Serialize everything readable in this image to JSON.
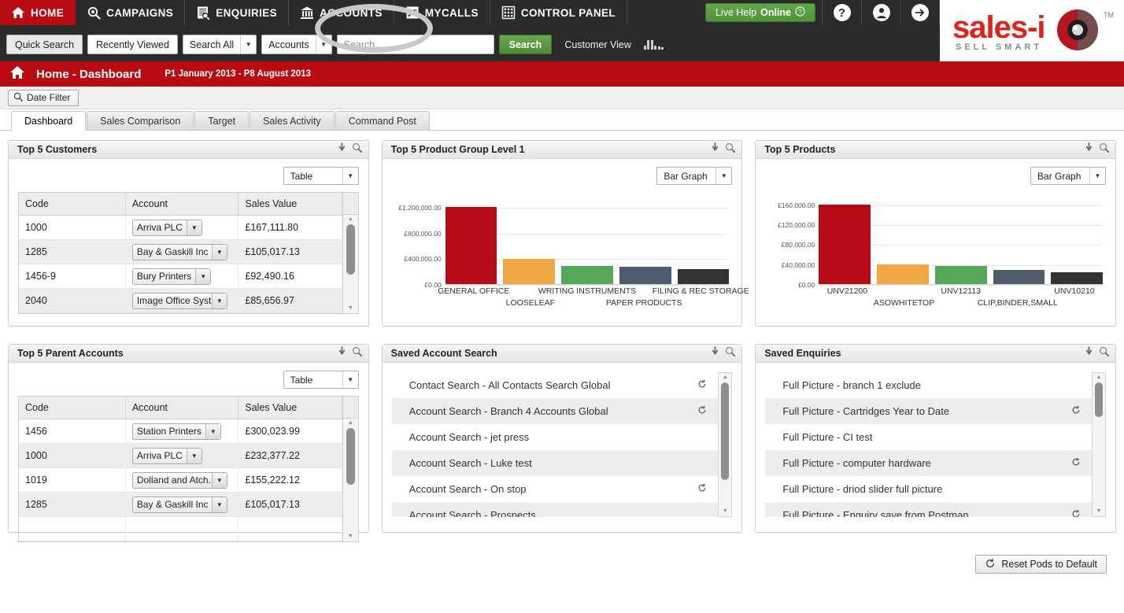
{
  "topnav": {
    "items": [
      {
        "label": "HOME",
        "icon": "home-icon",
        "active": true
      },
      {
        "label": "CAMPAIGNS",
        "icon": "campaigns-icon",
        "active": false
      },
      {
        "label": "ENQUIRIES",
        "icon": "enquiries-icon",
        "active": false
      },
      {
        "label": "ACCOUNTS",
        "icon": "accounts-bank-icon",
        "active": false
      },
      {
        "label": "MYCALLS",
        "icon": "mycalls-checklist-icon",
        "active": false
      },
      {
        "label": "CONTROL PANEL",
        "icon": "control-panel-icon",
        "active": false
      }
    ],
    "live_help": {
      "prefix": "Live Help ",
      "strong": "Online",
      "icon": "info-circle-icon"
    },
    "help_icon": "question-mark-icon",
    "account_icon": "user-avatar-icon",
    "logout_icon": "arrow-right-circle-icon",
    "logo": {
      "name": "sales-i",
      "tagline": "SELL SMART",
      "trademark": "TM"
    }
  },
  "searchbar": {
    "quick_search": "Quick Search",
    "recently_viewed": "Recently Viewed",
    "scope": "Search All",
    "entity": "Accounts",
    "placeholder": "Search...",
    "search_button": "Search",
    "customer_view": "Customer View",
    "mini_chart_icon": "bar-chart-icon"
  },
  "titlebar": {
    "home_icon": "home-icon",
    "title": "Home - Dashboard",
    "period": "P1 January 2013 - P8 August 2013"
  },
  "filterbar": {
    "date_filter": "Date Filter",
    "date_filter_icon": "search-icon"
  },
  "tabs": [
    {
      "label": "Dashboard",
      "active": true
    },
    {
      "label": "Sales Comparison",
      "active": false
    },
    {
      "label": "Target",
      "active": false
    },
    {
      "label": "Sales Activity",
      "active": false
    },
    {
      "label": "Command Post",
      "active": false
    }
  ],
  "pods": {
    "top5customers": {
      "title": "Top 5 Customers",
      "view": "Table",
      "columns": [
        "Code",
        "Account",
        "Sales Value"
      ],
      "rows": [
        {
          "code": "1000",
          "account": "Arriva PLC",
          "value": "£167,111.80"
        },
        {
          "code": "1285",
          "account": "Bay & Gaskill Inc",
          "value": "£105,017.13"
        },
        {
          "code": "1456-9",
          "account": "Bury Printers",
          "value": "£92,490.16"
        },
        {
          "code": "2040",
          "account": "Image Office Syst...",
          "value": "£85,656.97"
        }
      ]
    },
    "top5parent": {
      "title": "Top 5 Parent Accounts",
      "view": "Table",
      "columns": [
        "Code",
        "Account",
        "Sales Value"
      ],
      "rows": [
        {
          "code": "1456",
          "account": "Station Printers",
          "value": "£300,023.99"
        },
        {
          "code": "1000",
          "account": "Arriva PLC",
          "value": "£232,377.22"
        },
        {
          "code": "1019",
          "account": "Dolland and Atch...",
          "value": "£155,222.12"
        },
        {
          "code": "1285",
          "account": "Bay & Gaskill Inc",
          "value": "£105,017.13"
        }
      ]
    },
    "top5group": {
      "title": "Top 5 Product Group Level 1",
      "view": "Bar Graph"
    },
    "top5products": {
      "title": "Top 5 Products",
      "view": "Bar Graph"
    },
    "savedaccountsearch": {
      "title": "Saved Account Search",
      "items": [
        {
          "label": "Contact Search - All Contacts Search  Global",
          "refresh": true
        },
        {
          "label": "Account Search - Branch 4 Accounts Global",
          "refresh": true
        },
        {
          "label": "Account Search - jet press",
          "refresh": false
        },
        {
          "label": "Account Search - Luke test",
          "refresh": false
        },
        {
          "label": "Account Search - On stop",
          "refresh": true
        },
        {
          "label": "Account Search - Prospects",
          "refresh": false
        }
      ]
    },
    "savedenquiries": {
      "title": "Saved Enquiries",
      "items": [
        {
          "label": "Full Picture - branch 1 exclude",
          "refresh": false
        },
        {
          "label": "Full Picture - Cartridges Year to Date",
          "refresh": true
        },
        {
          "label": "Full Picture - CI test",
          "refresh": false
        },
        {
          "label": "Full Picture - computer hardware",
          "refresh": true
        },
        {
          "label": "Full Picture - driod slider full picture",
          "refresh": false
        },
        {
          "label": "Full Picture - Enquiry save from Postman",
          "refresh": true
        }
      ]
    },
    "pod_icons": {
      "collapse": "down-arrow-icon",
      "zoom": "magnifier-icon"
    }
  },
  "footer": {
    "reset_label": "Reset Pods to Default",
    "reset_icon": "refresh-circle-icon"
  },
  "colors": {
    "brand_red": "#b80c12",
    "bar1": "#b50b16",
    "bar2": "#efa841",
    "bar3": "#56a75a",
    "bar4": "#505c6e",
    "bar5": "#333333",
    "green_button": "#4f8b37"
  },
  "chart_data": [
    {
      "type": "bar",
      "title": "Top 5 Product Group Level 1",
      "categories": [
        "GENERAL OFFICE",
        "LOOSELEAF",
        "WRITING INSTRUMENTS",
        "PAPER PRODUCTS",
        "FILING & REC STORAGE"
      ],
      "values": [
        1215000,
        398000,
        281000,
        278000,
        241000
      ],
      "colors": [
        "#b50b16",
        "#efa841",
        "#56a75a",
        "#505c6e",
        "#333333"
      ],
      "xlabel": "",
      "ylabel": "",
      "ylim": [
        0,
        1400000
      ],
      "yticks": [
        0,
        400000,
        800000,
        1200000
      ],
      "yticklabels": [
        "£0.00",
        "£400,000.00",
        "£800,000.00",
        "£1,200,000.00"
      ],
      "grid": true,
      "legend": "none"
    },
    {
      "type": "bar",
      "title": "Top 5 Products",
      "categories": [
        "UNV21200",
        "ASOWHITETOP",
        "UNV12113",
        "CLIP,BINDER,SMALL",
        "UNV10210"
      ],
      "values": [
        161500,
        39200,
        36400,
        28300,
        24500
      ],
      "colors": [
        "#b50b16",
        "#efa841",
        "#56a75a",
        "#505c6e",
        "#333333"
      ],
      "xlabel": "",
      "ylabel": "",
      "ylim": [
        0,
        180000
      ],
      "yticks": [
        0,
        40000,
        80000,
        120000,
        160000
      ],
      "yticklabels": [
        "£0.00",
        "£40,000.00",
        "£80,000.00",
        "£120,000.00",
        "£160,000.00"
      ],
      "grid": true,
      "legend": "none"
    }
  ]
}
